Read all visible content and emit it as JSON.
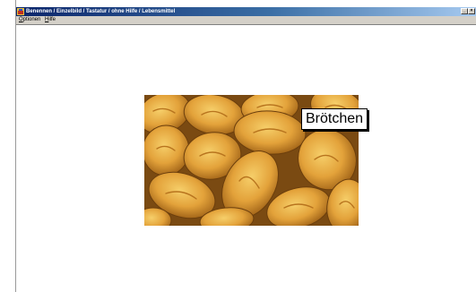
{
  "window": {
    "title": "Benennen / Einzelbild / Tastatur / ohne Hilfe / Lebensmittel"
  },
  "menu": {
    "items": [
      {
        "label_underlined": "O",
        "label_rest": "ptionen"
      },
      {
        "label_underlined": "H",
        "label_rest": "ilfe"
      }
    ]
  },
  "content": {
    "image_subject": "bread-rolls",
    "word_label": "Brötchen"
  },
  "colors": {
    "titlebar_start": "#0a246a",
    "titlebar_end": "#a6caf0",
    "menubar": "#d4d0c8",
    "background": "#ffffff"
  }
}
